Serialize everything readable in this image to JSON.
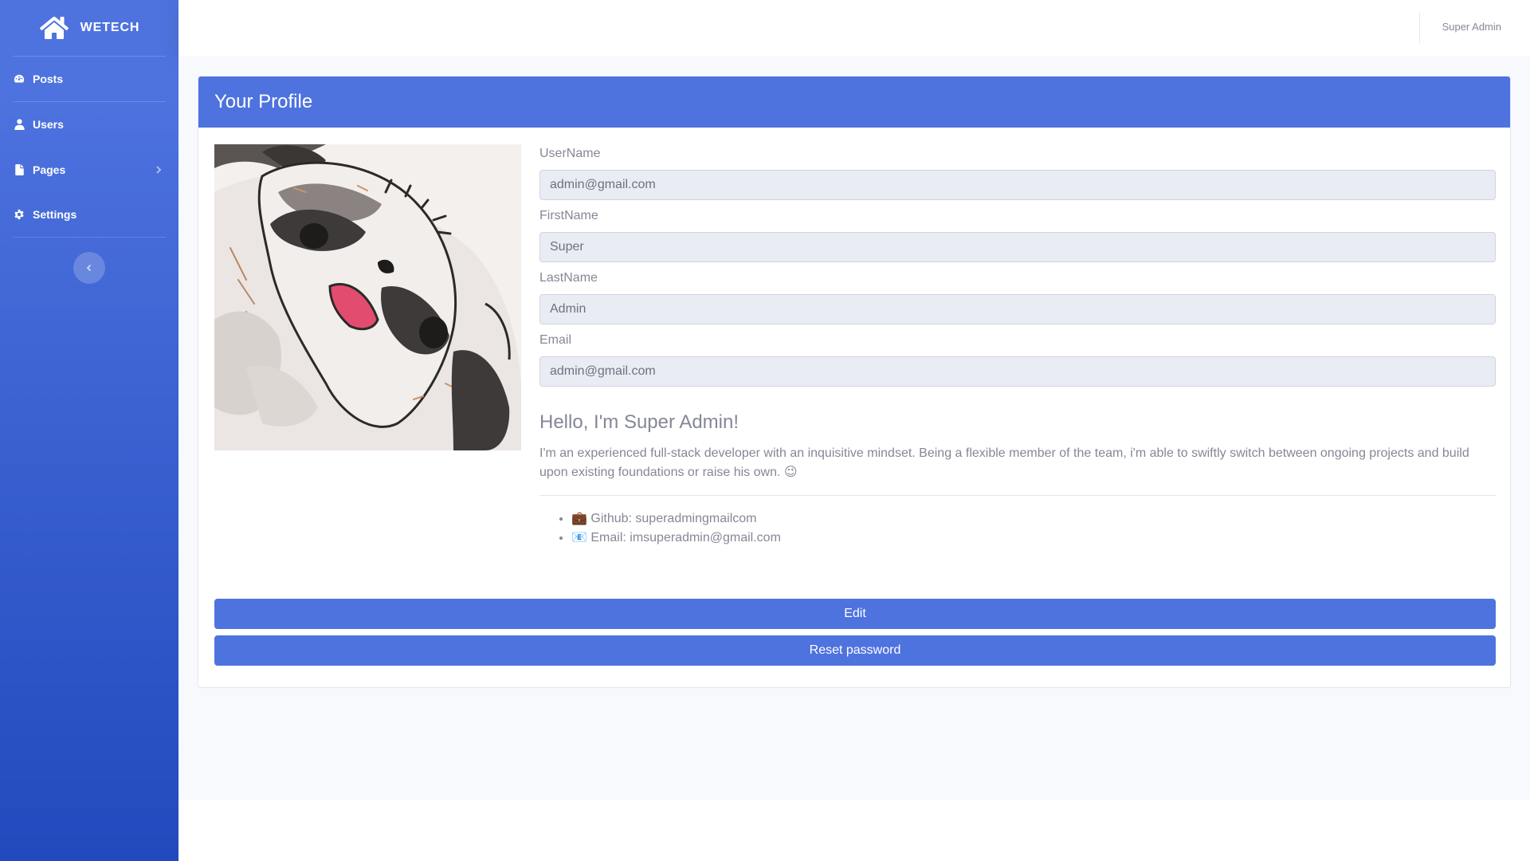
{
  "brand": {
    "name": "WETECH",
    "icon": "home-icon"
  },
  "sidebar": {
    "items": [
      {
        "label": "Posts",
        "icon": "tachometer-icon"
      },
      {
        "label": "Users",
        "icon": "user-icon"
      },
      {
        "label": "Pages",
        "icon": "file-icon",
        "has_submenu": true
      },
      {
        "label": "Settings",
        "icon": "gear-icon"
      }
    ],
    "toggle_icon": "chevron-left-icon"
  },
  "topbar": {
    "user_name": "Super Admin"
  },
  "profile": {
    "title": "Your Profile",
    "fields": [
      {
        "label": "UserName",
        "value": "admin@gmail.com"
      },
      {
        "label": "FirstName",
        "value": "Super"
      },
      {
        "label": "LastName",
        "value": "Admin"
      },
      {
        "label": "Email",
        "value": "admin@gmail.com"
      }
    ],
    "greeting": "Hello, I'm Super Admin!",
    "bio": "I'm an experienced full-stack developer with an inquisitive mindset. Being a flexible member of the team, i'm able to swiftly switch between ongoing projects and build upon existing foundations or raise his own. 😉",
    "contacts": [
      {
        "emoji": "💼",
        "text": "Github: superadmingmailcom"
      },
      {
        "emoji": "📧",
        "text": "Email: imsuperadmin@gmail.com"
      }
    ],
    "edit_label": "Edit",
    "reset_label": "Reset password"
  },
  "colors": {
    "primary": "#4e73df",
    "sidebar_end": "#224abe",
    "text": "#858796",
    "input_bg": "#eaecf4"
  }
}
